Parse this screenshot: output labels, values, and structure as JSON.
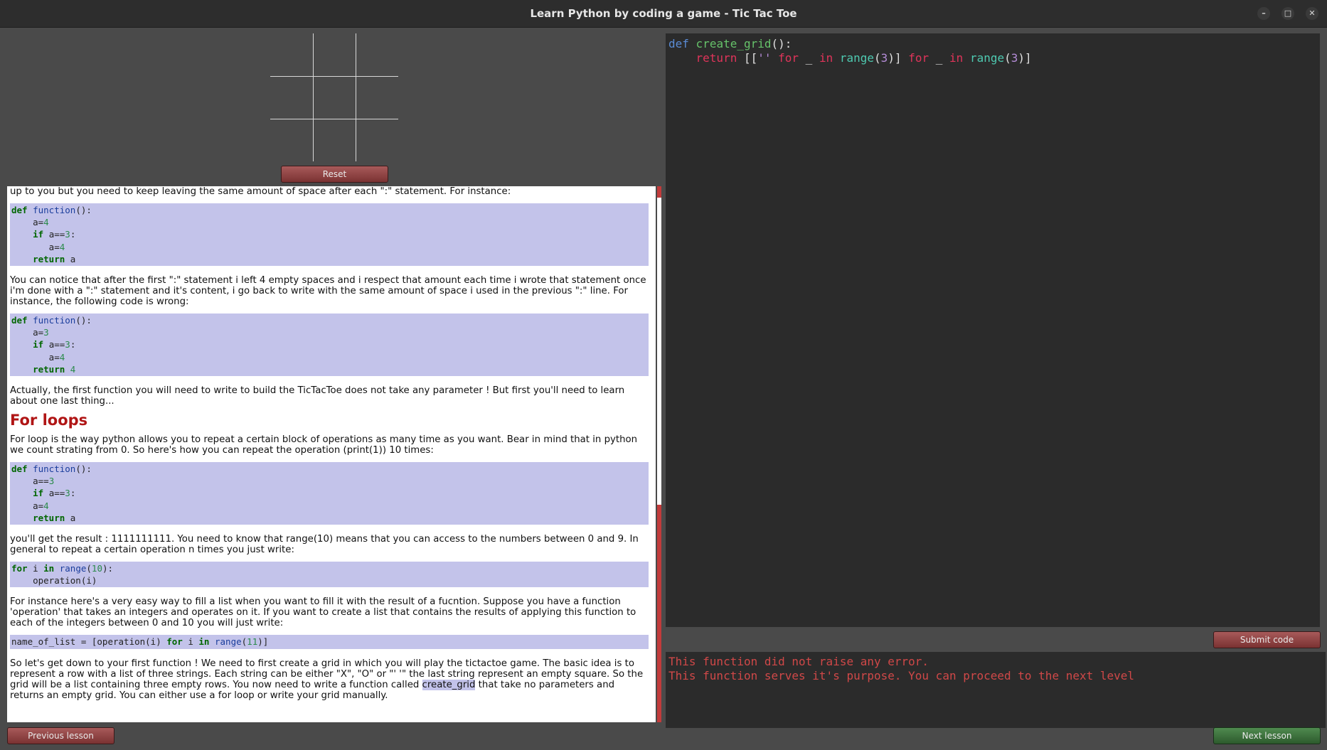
{
  "window": {
    "title": "Learn Python by coding a game - Tic Tac Toe",
    "minimize_glyph": "–",
    "maximize_glyph": "□",
    "close_glyph": "✕"
  },
  "board": {
    "label": ""
  },
  "buttons": {
    "reset": "Reset",
    "previous": "Previous lesson",
    "submit": "Submit code",
    "next": "Next lesson"
  },
  "lesson": {
    "p_intro": "up to you but you need to keep leaving the same amount of space after each \":\" statement. For instance:",
    "p_notice": "You can notice that after the first \":\" statement i left 4 empty spaces and i respect that amount each time i wrote that statement once i'm done with a \":\" statement and it's content, i go back to write with the same amount of space i used in the previous \":\" line. For instance, the following code is wrong:",
    "p_actually": "Actually, the first function you will need to write to build the TicTacToe does not take any parameter ! But first you'll need to learn about one last thing...",
    "h_forloops": "For loops",
    "p_forloop": "For loop is the way python allows you to repeat a certain block of operations as many time as you want. Bear in mind that in python we count strating from 0. So here's how you can repeat the operation (print(1)) 10 times:",
    "p_result": "you'll get the result : 1111111111. You need to know that range(10) means that you can access to the numbers between 0 and 9. In general to repeat a certain operation n times you just write:",
    "p_instance": "For instance here's a very easy way to fill a list when you want to fill it with the result of a fucntion. Suppose you have a function 'operation' that takes an integers and operates on it. If you want to create a list that contains the results of applying this function to each of the integers between 0 and 10 you will just write:",
    "p_final_a": "So let's get down to your first function ! We need to first create a grid in which you will play the tictactoe game. The basic idea is to represent a row with a list of three strings. Each string can be either \"X\", \"O\" or \"' '\" the last string represent an empty square. So the grid will be a list containing three empty rows. You now need to write a function called ",
    "p_final_hl": "create_grid",
    "p_final_b": " that take no parameters and returns an empty grid. You can either use a for loop or write your grid manually.",
    "code1": [
      "def function():",
      "    a=4",
      "    if a==3:",
      "       a=4",
      "    return a"
    ],
    "code2": [
      "def function():",
      "    a=3",
      "    if a==3:",
      "       a=4",
      "    return 4"
    ],
    "code3": [
      "def function():",
      "    a==3",
      "    if a==3:",
      "    a=4",
      "    return a"
    ],
    "code4": [
      "for i in range(10):",
      "    operation(i)"
    ],
    "code5": [
      "name_of_list = [operation(i) for i in range(11)]"
    ]
  },
  "editor": {
    "line1": [
      "def",
      " ",
      "create_grid",
      "():"
    ],
    "line2": [
      "    ",
      "return",
      " [[",
      "''",
      " ",
      "for",
      " _ ",
      "in",
      " ",
      "range",
      "(",
      "3",
      ")]",
      " ",
      "for",
      " _ ",
      "in",
      " ",
      "range",
      "(",
      "3",
      ")]"
    ]
  },
  "output": {
    "line1": "This function did not raise any error.",
    "line2": "This function serves it's purpose. You can proceed to the next level"
  },
  "colors": {
    "accent_red": "#c23b3b",
    "heading_red": "#b01515",
    "code_bg": "#c3c3ea",
    "editor_bg": "#2b2b2b",
    "next_green": "#3d6e3d"
  }
}
